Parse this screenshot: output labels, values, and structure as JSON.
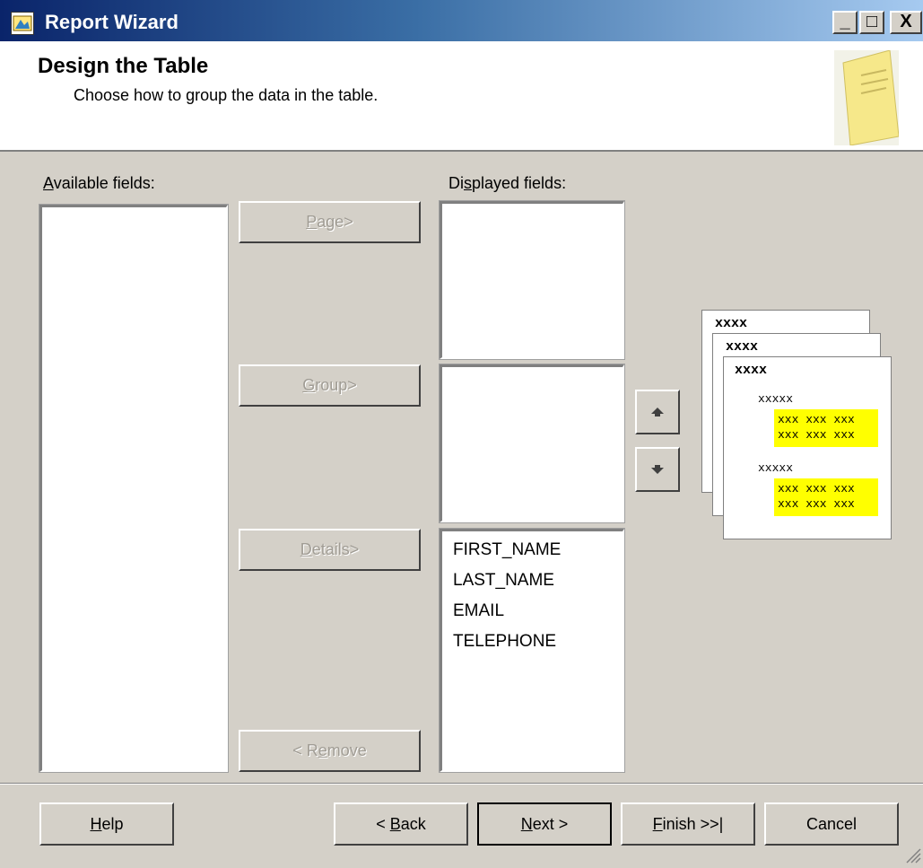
{
  "window": {
    "title": "Report Wizard",
    "minimize": "_",
    "maximize": "□",
    "close": "X"
  },
  "header": {
    "title": "Design the Table",
    "subtitle": "Choose how to group the data in the table."
  },
  "available": {
    "label_u": "A",
    "label_rest": "vailable fields:",
    "items": []
  },
  "displayed": {
    "label_pre": "Di",
    "label_u": "s",
    "label_rest": "played fields:"
  },
  "page_list": {
    "items": []
  },
  "group_list": {
    "items": []
  },
  "details_list": {
    "items": [
      "FIRST_NAME",
      "LAST_NAME",
      "EMAIL",
      "TELEPHONE"
    ]
  },
  "buttons": {
    "page": {
      "u": "P",
      "rest": "age>"
    },
    "group": {
      "u": "G",
      "rest": "roup>"
    },
    "details": {
      "u": "D",
      "rest": "etails>"
    },
    "remove": {
      "pre": "< R",
      "u": "e",
      "rest": "move"
    },
    "move_up": "▲",
    "move_down": "▼"
  },
  "preview": {
    "header1": "xxxx",
    "header2": "xxxx",
    "header3": "xxxx",
    "group1": "xxxxx",
    "group2": "xxxxx",
    "detail_line": "xxx xxx xxx"
  },
  "footer": {
    "help": {
      "u": "H",
      "rest": "elp"
    },
    "back": {
      "pre": "< ",
      "u": "B",
      "rest": "ack"
    },
    "next": {
      "u": "N",
      "rest": "ext >"
    },
    "finish": {
      "u": "F",
      "rest": "inish >>|"
    },
    "cancel": "Cancel"
  },
  "colors": {
    "titlebar_start": "#0a246a",
    "titlebar_end": "#a6caf0",
    "face": "#d4d0c8",
    "highlight": "#ffff00"
  }
}
